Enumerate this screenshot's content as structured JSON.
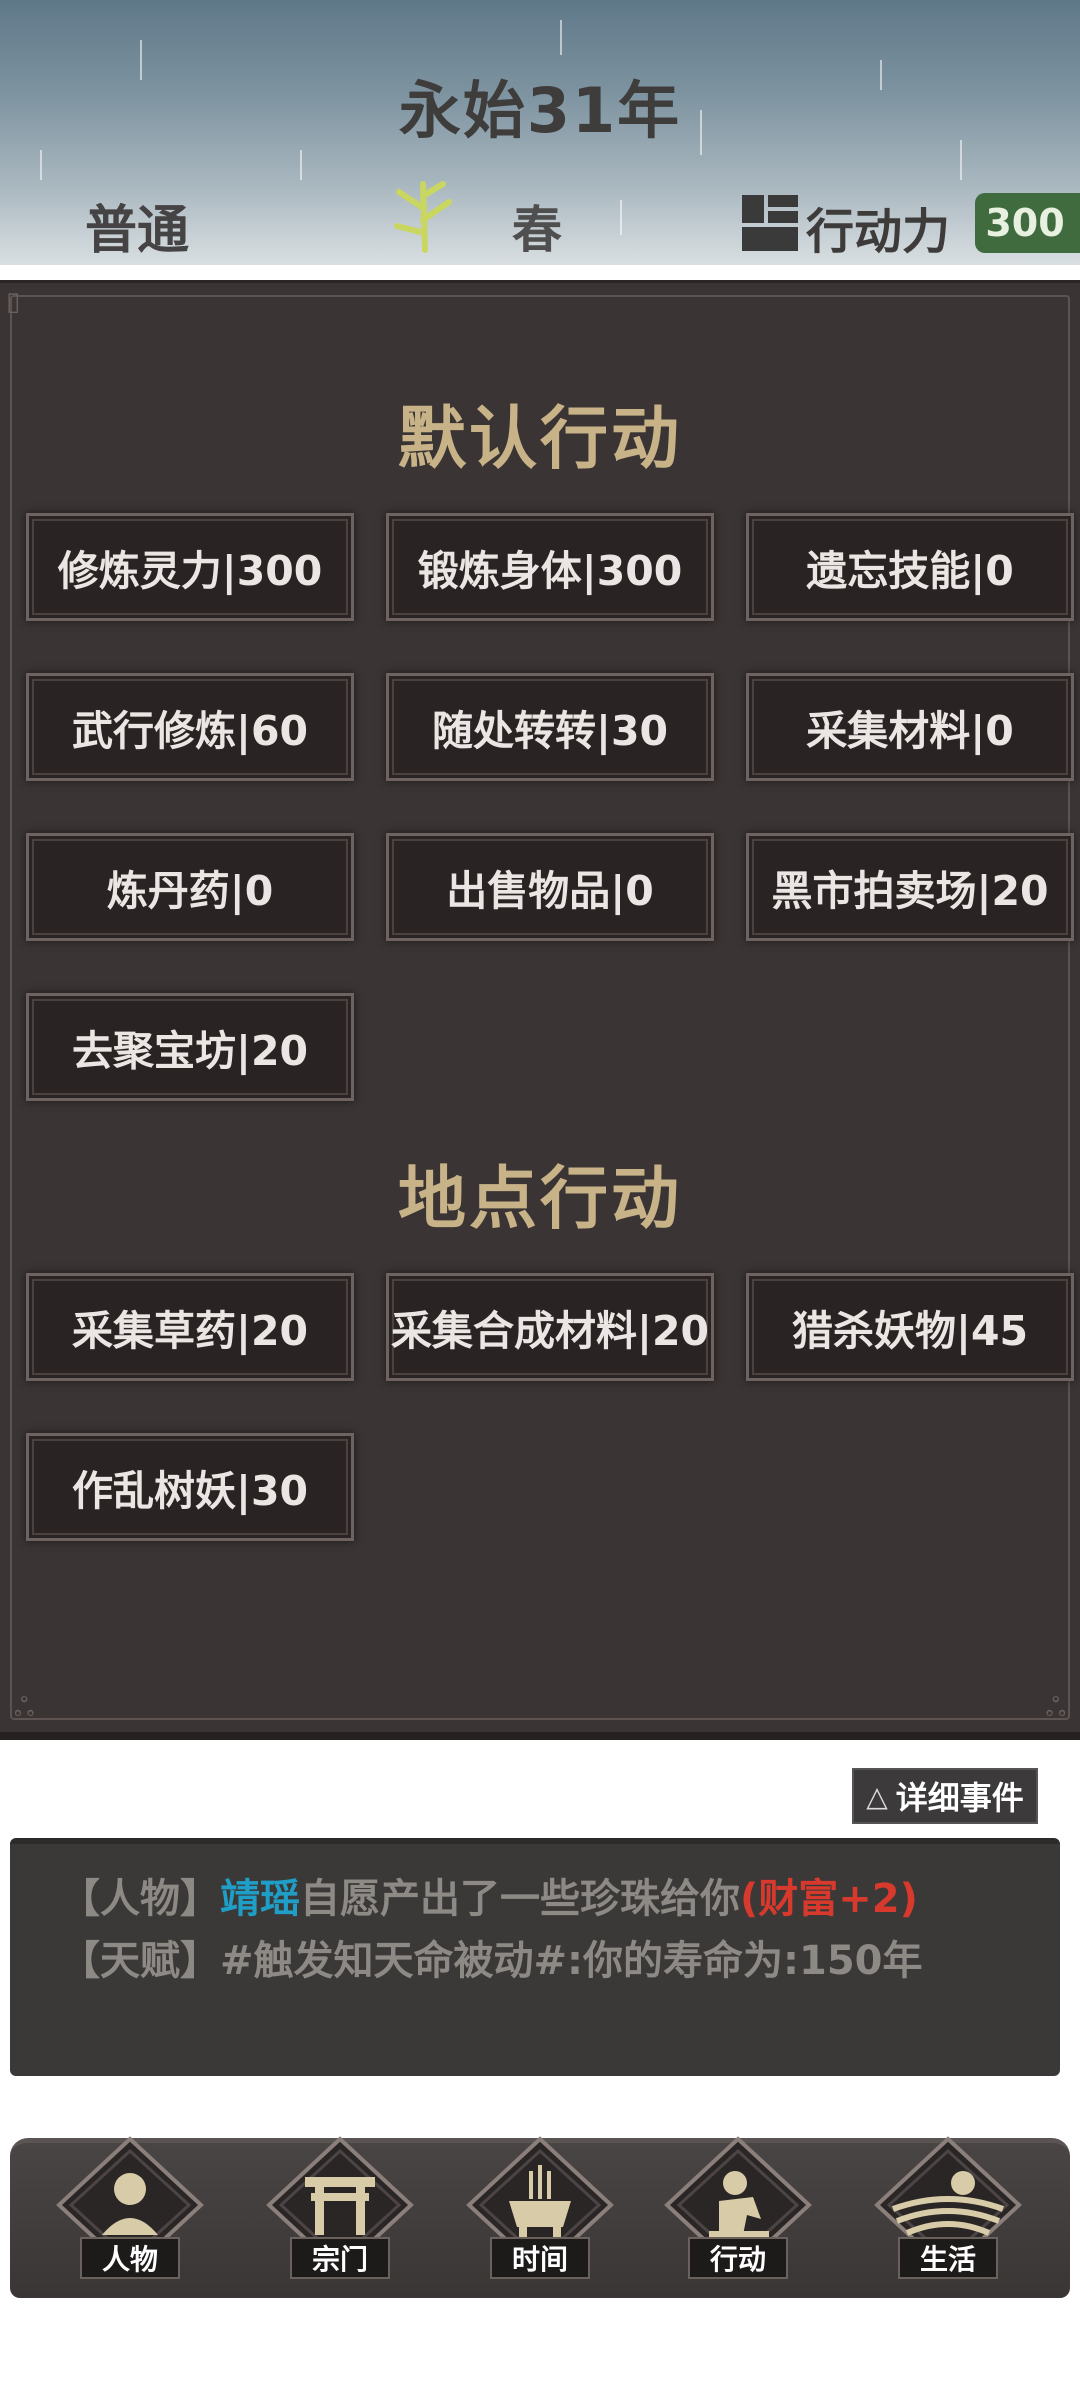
{
  "header": {
    "year": "永始31年",
    "difficulty": "普通",
    "season": "春",
    "action_power_label": "行动力",
    "action_power_value": "300",
    "season_icon": "bamboo-icon",
    "action_power_icon": "action-block-icon"
  },
  "sections": {
    "default_title": "默认行动",
    "location_title": "地点行动"
  },
  "default_actions": [
    "修炼灵力|300",
    "锻炼身体|300",
    "遗忘技能|0",
    "武行修炼|60",
    "随处转转|30",
    "采集材料|0",
    "炼丹药|0",
    "出售物品|0",
    "黑市拍卖场|20",
    "去聚宝坊|20"
  ],
  "location_actions": [
    "采集草药|20",
    "采集合成材料|20",
    "猎杀妖物|45",
    "作乱树妖|30"
  ],
  "log": {
    "detail_button": "详细事件",
    "detail_icon": "△",
    "line1": {
      "tag": "【人物】",
      "name": "靖瑶",
      "text": "自愿产出了一些珍珠给你",
      "reward": "(财富+2)"
    },
    "line2": {
      "tag": "【天赋】",
      "text": "#触发知天命被动#:你的寿命为:150年"
    }
  },
  "nav": [
    {
      "label": "人物",
      "icon": "person-icon"
    },
    {
      "label": "宗门",
      "icon": "sect-gate-icon"
    },
    {
      "label": "时间",
      "icon": "incense-burner-icon"
    },
    {
      "label": "行动",
      "icon": "action-figure-icon"
    },
    {
      "label": "生活",
      "icon": "landscape-icon"
    }
  ],
  "colors": {
    "panel_bg": "#3a3434",
    "title_gold": "#c7b387",
    "ap_green": "#3f6b3f",
    "name_blue": "#1f9fc7",
    "reward_red": "#d73a2d"
  }
}
